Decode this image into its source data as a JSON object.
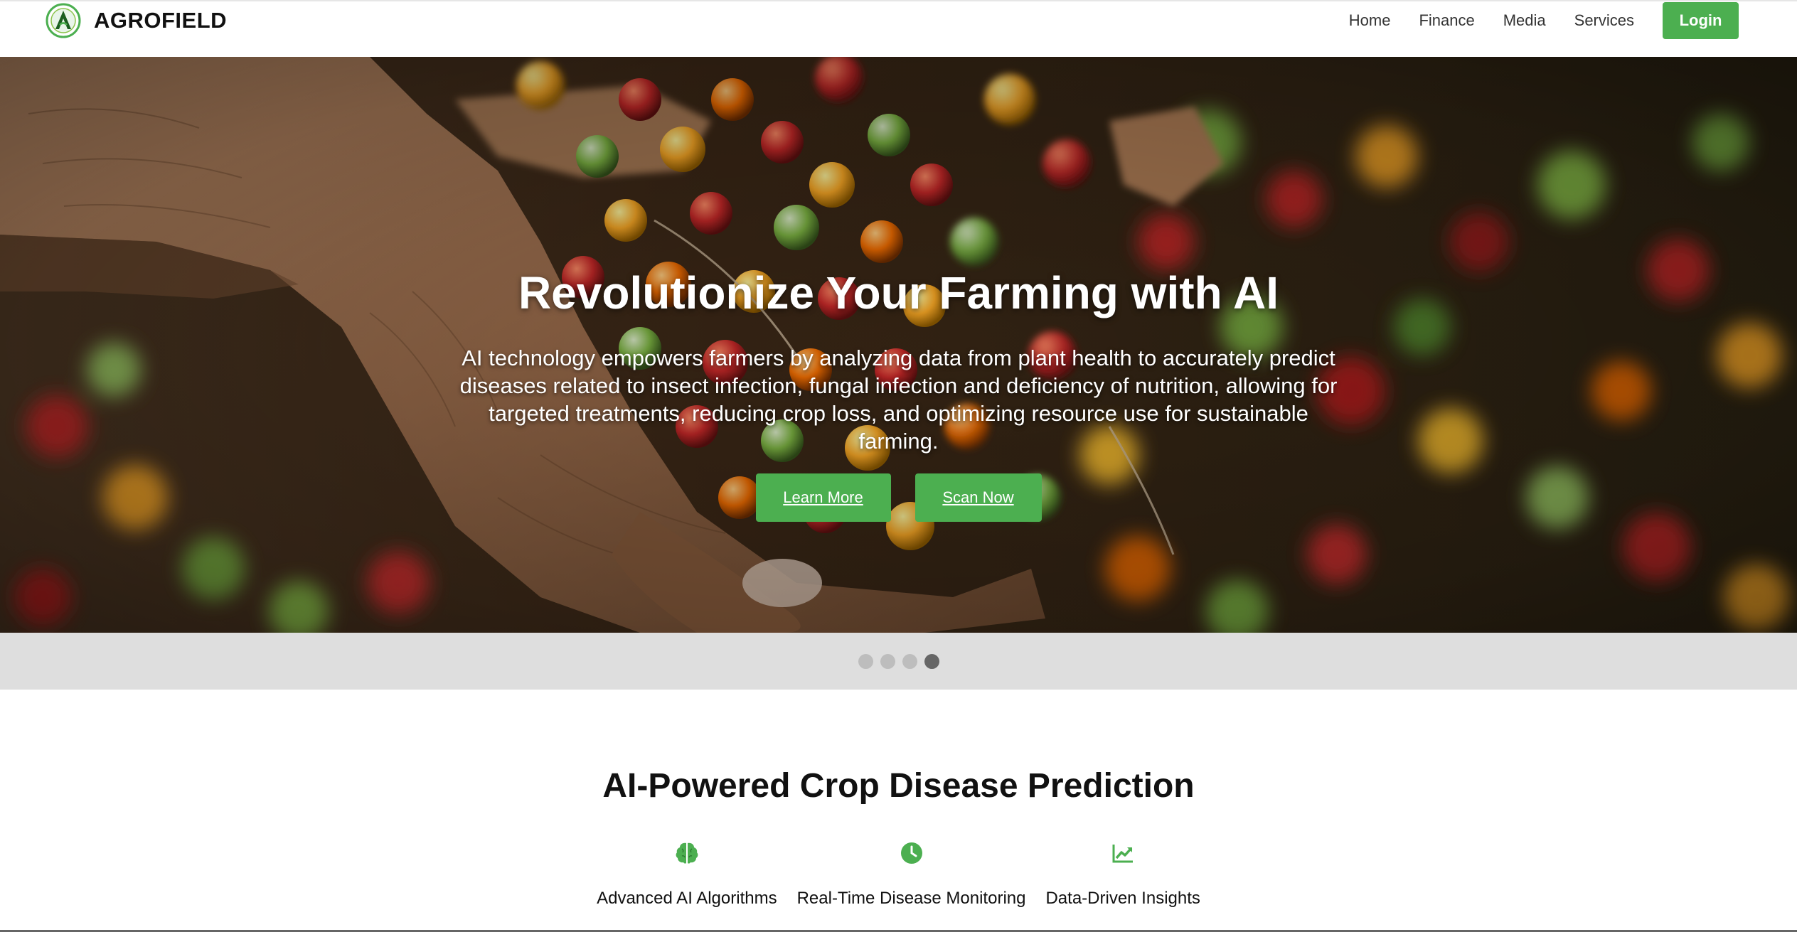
{
  "brand": {
    "name": "AGROFIELD"
  },
  "nav": {
    "items": [
      {
        "label": "Home"
      },
      {
        "label": "Finance"
      },
      {
        "label": "Media"
      },
      {
        "label": "Services"
      }
    ],
    "login_label": "Login"
  },
  "hero": {
    "title": "Revolutionize Your Farming with AI",
    "description": "AI technology empowers farmers by analyzing data from plant health to accurately predict diseases related to insect infection, fungal infection and deficiency of nutrition, allowing for targeted treatments, reducing crop loss, and optimizing resource use for sustainable farming.",
    "learn_more_label": "Learn More",
    "scan_now_label": "Scan Now",
    "slide_count": 4,
    "active_slide": 4
  },
  "features": {
    "title": "AI-Powered Crop Disease Prediction",
    "items": [
      {
        "label": "Advanced AI Algorithms",
        "icon": "brain-icon"
      },
      {
        "label": "Real-Time Disease Monitoring",
        "icon": "clock-icon"
      },
      {
        "label": "Data-Driven Insights",
        "icon": "chart-line-icon"
      }
    ]
  },
  "colors": {
    "accent": "#4caf50",
    "dot_inactive": "#bdbdbd",
    "dot_active": "#666666",
    "dots_bar": "#dedede"
  }
}
